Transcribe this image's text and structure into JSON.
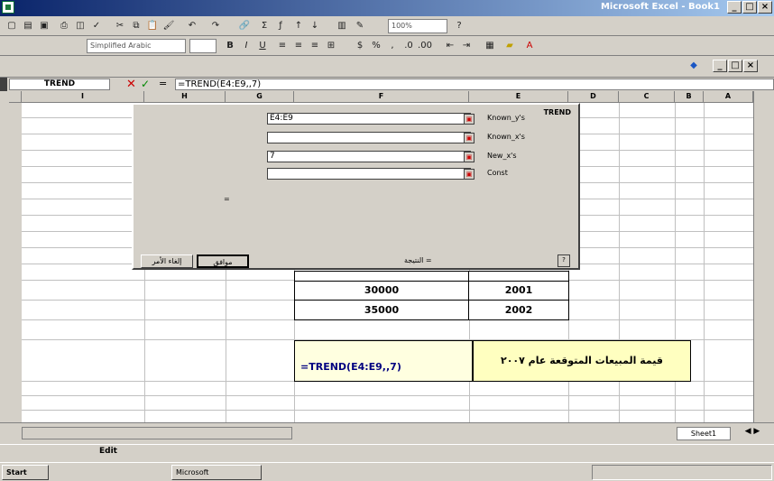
{
  "window": {
    "title": "Microsoft Excel - Book1",
    "controls": [
      "_",
      "□",
      "×"
    ]
  },
  "toolbar": {
    "font_name": "Simplified Arabic",
    "zoom": "100%"
  },
  "formula_bar": {
    "name_box": "TREND",
    "formula": "=TREND(E4:E9,,7)"
  },
  "columns": [
    "I",
    "H",
    "G",
    "F",
    "E",
    "D",
    "C",
    "B",
    "A"
  ],
  "dialog": {
    "title": "TREND",
    "fields": [
      {
        "label": "Known_y's",
        "value": "E4:E9"
      },
      {
        "label": "Known_x's",
        "value": ""
      },
      {
        "label": "New_x's",
        "value": "7"
      },
      {
        "label": "Const",
        "value": ""
      }
    ],
    "result_label": "=",
    "ok_label": "موافق",
    "cancel_label": "إلغاء الأمر",
    "formula_result": "النتيجة ="
  },
  "sheet": {
    "table_rows": [
      {
        "value": "30000",
        "year": "2001"
      },
      {
        "value": "35000",
        "year": "2002"
      }
    ],
    "trend_formula": "=TREND(E4:E9,,7)",
    "trend_label": "قيمة المبيعات المتوقعة عام ٢٠٠٧"
  },
  "sheet_tabs": {
    "active": "Sheet1"
  },
  "status_bar": {
    "mode": "Edit"
  },
  "taskbar": {
    "start_label": "Start",
    "tasks": [
      "Microsoft"
    ]
  }
}
